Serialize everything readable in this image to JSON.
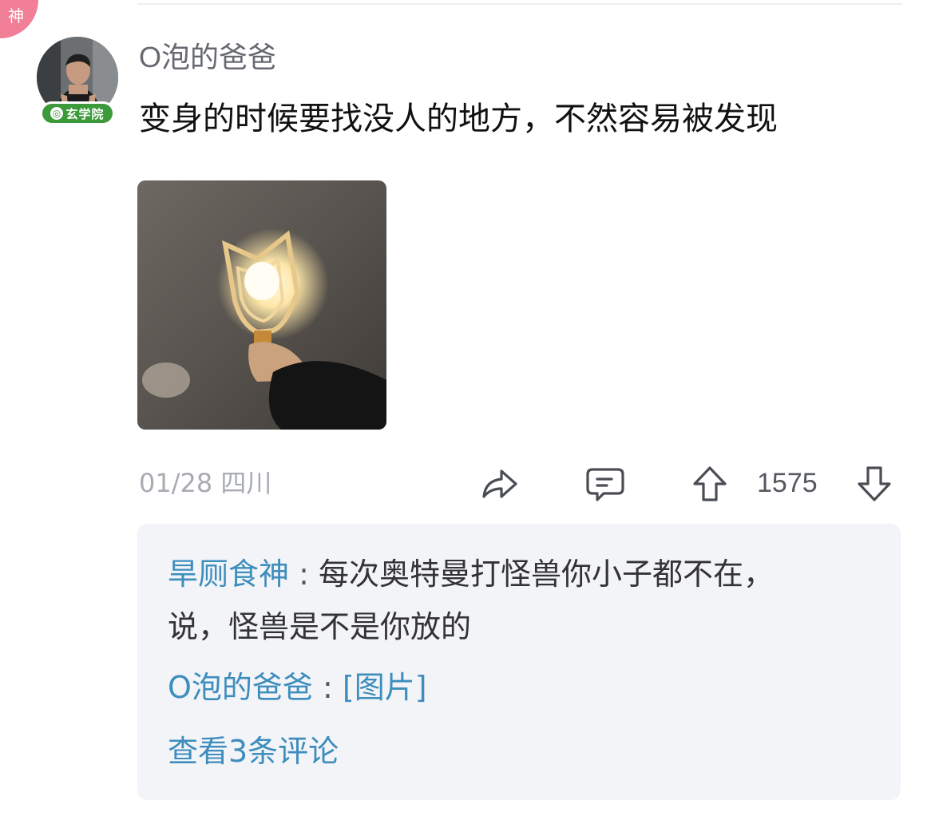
{
  "badge": {
    "label": "神"
  },
  "post": {
    "author": "O泡的爸爸",
    "author_tag": "玄学院",
    "text": "变身的时候要找没人的地方，不然容易被发现",
    "date": "01/28",
    "location": "四川",
    "vote_count": "1575"
  },
  "icons": {
    "share": "share-arrow-icon",
    "comment": "comment-bubble-icon",
    "upvote": "arrow-up-icon",
    "downvote": "arrow-down-icon"
  },
  "comments": [
    {
      "author": "旱厕食神",
      "separator": ":",
      "text_line1": "每次奥特曼打怪兽你小子都不在，",
      "text_line2": "说，怪兽是不是你放的"
    },
    {
      "author": "O泡的爸爸",
      "separator": ":",
      "text_line1": "[图片]"
    }
  ],
  "view_more": "查看3条评论",
  "colors": {
    "link_blue": "#3d8dbd",
    "badge_pink": "#f07f97",
    "tag_green": "#3d9a3a",
    "comment_bg": "#f3f4f8"
  }
}
